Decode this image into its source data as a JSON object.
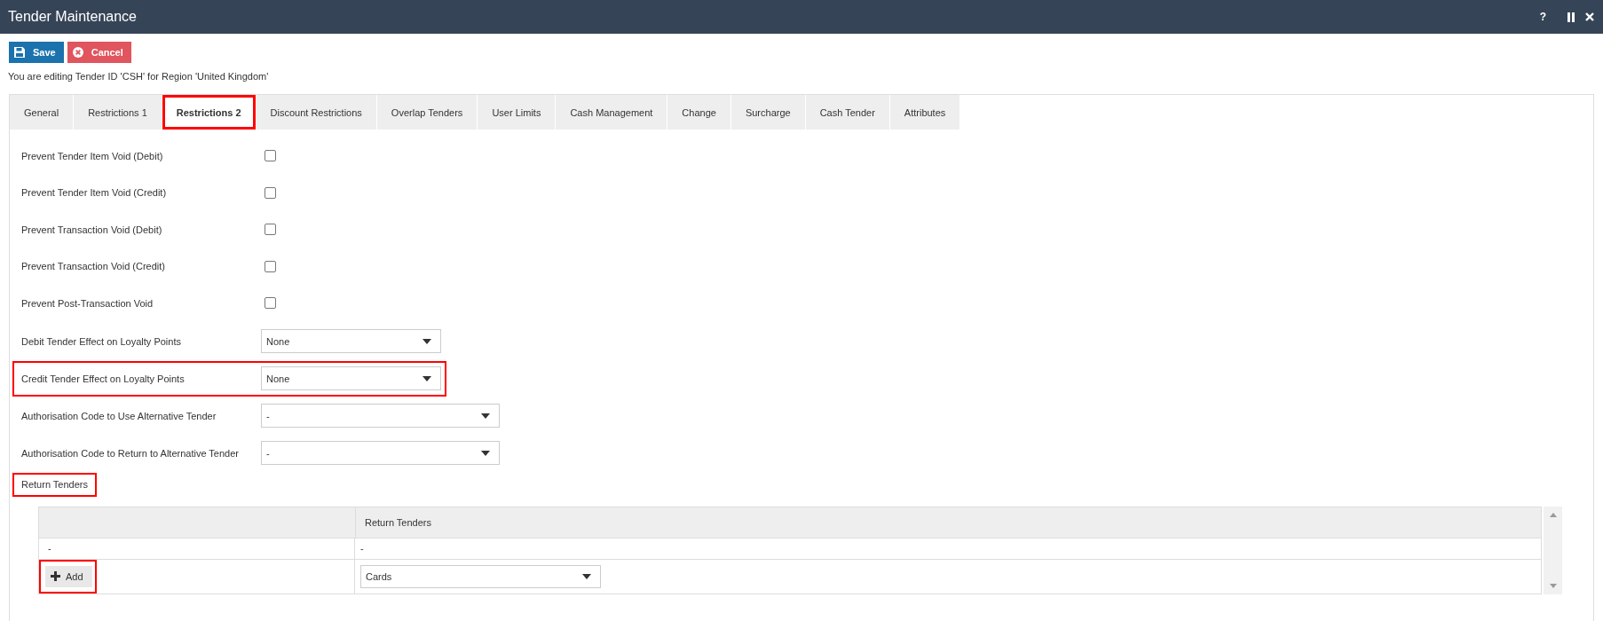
{
  "window": {
    "title": "Tender Maintenance",
    "help": "?"
  },
  "toolbar": {
    "buttons": [
      {
        "kind": "save",
        "label": "Save"
      },
      {
        "kind": "cancel",
        "label": "Cancel"
      }
    ]
  },
  "context_text": "You are editing Tender ID 'CSH' for Region 'United Kingdom'",
  "tabs": [
    {
      "label": "General",
      "selected": false,
      "highlighted": false
    },
    {
      "label": "Restrictions 1",
      "selected": false,
      "highlighted": false
    },
    {
      "label": "Restrictions 2",
      "selected": true,
      "highlighted": true
    },
    {
      "label": "Discount Restrictions",
      "selected": false,
      "highlighted": false
    },
    {
      "label": "Overlap Tenders",
      "selected": false,
      "highlighted": false
    },
    {
      "label": "User Limits",
      "selected": false,
      "highlighted": false
    },
    {
      "label": "Cash Management",
      "selected": false,
      "highlighted": false
    },
    {
      "label": "Change",
      "selected": false,
      "highlighted": false
    },
    {
      "label": "Surcharge",
      "selected": false,
      "highlighted": false
    },
    {
      "label": "Cash Tender",
      "selected": false,
      "highlighted": false
    },
    {
      "label": "Attributes",
      "selected": false,
      "highlighted": false
    }
  ],
  "fields": [
    {
      "kind": "checkbox",
      "label": "Prevent Tender Item Void (Debit)",
      "checked": false,
      "highlighted": false
    },
    {
      "kind": "checkbox",
      "label": "Prevent Tender Item Void (Credit)",
      "checked": false,
      "highlighted": false
    },
    {
      "kind": "checkbox",
      "label": "Prevent Transaction Void (Debit)",
      "checked": false,
      "highlighted": false
    },
    {
      "kind": "checkbox",
      "label": "Prevent Transaction Void (Credit)",
      "checked": false,
      "highlighted": false
    },
    {
      "kind": "checkbox",
      "label": "Prevent Post-Transaction Void",
      "checked": false,
      "highlighted": false
    },
    {
      "kind": "select",
      "label": "Debit Tender Effect on Loyalty Points",
      "value": "None",
      "highlighted": false
    },
    {
      "kind": "select",
      "label": "Credit Tender Effect on Loyalty Points",
      "value": "None",
      "highlighted": true
    },
    {
      "kind": "select",
      "label": "Authorisation Code to Use Alternative Tender",
      "value": "-",
      "highlighted": false
    },
    {
      "kind": "select",
      "label": "Authorisation Code to Return to Alternative Tender",
      "value": "-",
      "highlighted": false
    }
  ],
  "return_tenders": {
    "heading": "Return Tenders",
    "highlighted": true,
    "table": {
      "header": {
        "column_2": "Return Tenders"
      },
      "rows": [
        {
          "column_1": "-",
          "column_2": "-"
        }
      ],
      "add_button": {
        "label": "Add",
        "highlighted": true
      },
      "new_value": "Cards"
    }
  }
}
